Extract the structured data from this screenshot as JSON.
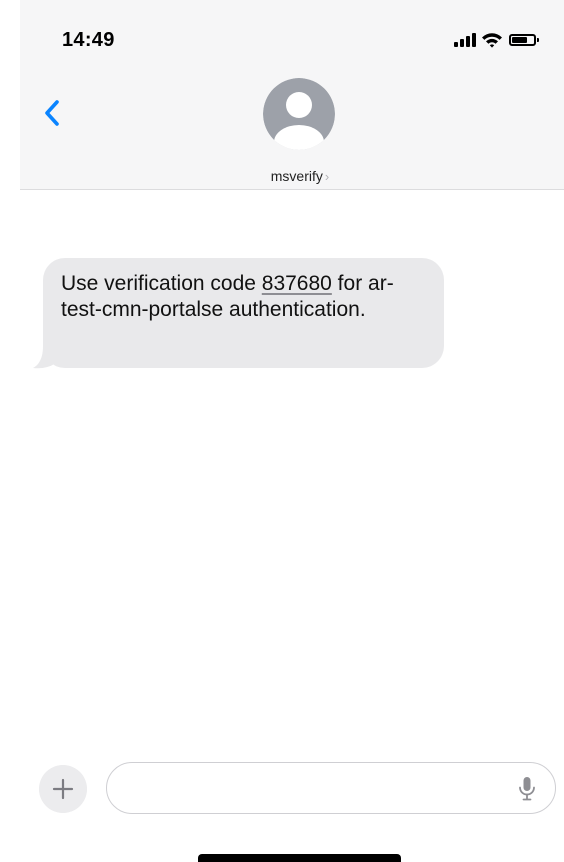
{
  "status_bar": {
    "time": "14:49",
    "signal_icon": "cellular-signal-icon",
    "wifi_icon": "wifi-icon",
    "battery_icon": "battery-icon"
  },
  "header": {
    "back_icon": "chevron-left-icon",
    "avatar_icon": "person-placeholder-icon",
    "contact_name": "msverify",
    "contact_chevron": "›"
  },
  "conversation": {
    "messages": [
      {
        "direction": "incoming",
        "text_before": "Use verification code ",
        "code": "837680",
        "text_after": " for ar-test-cmn-portalse authentication."
      }
    ]
  },
  "composer": {
    "add_icon": "plus-icon",
    "add_symbol": "+",
    "message_value": "",
    "placeholder": "",
    "mic_icon": "microphone-icon"
  },
  "colors": {
    "accent": "#0a84ff",
    "bubble_incoming": "#e9e9eb",
    "header_background": "#f6f6f7",
    "avatar": "#9da1a9"
  }
}
